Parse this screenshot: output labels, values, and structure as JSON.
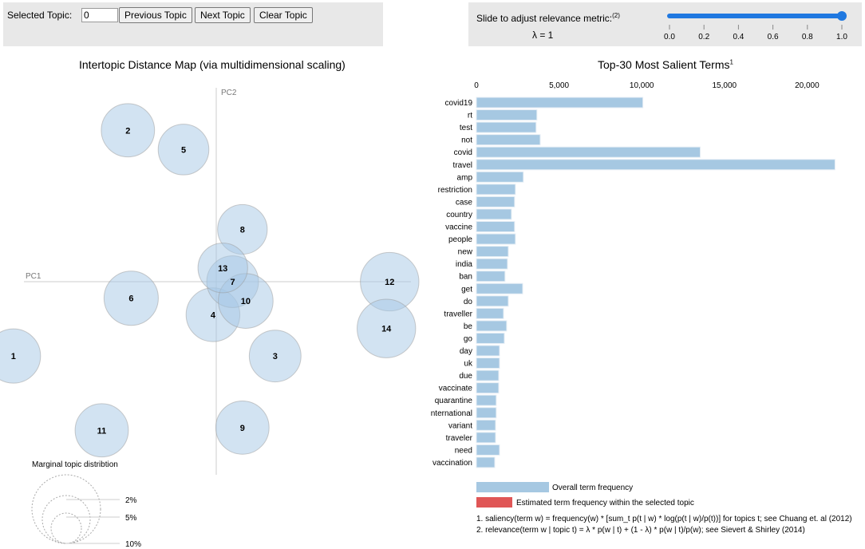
{
  "controls": {
    "selected_topic_label": "Selected Topic:",
    "selected_topic_value": "0",
    "previous_label": "Previous Topic",
    "next_label": "Next Topic",
    "clear_label": "Clear Topic",
    "slider_label": "Slide to adjust relevance metric:",
    "slider_footnote": "(2)",
    "lambda_text": "λ = 1",
    "slider_value": 1.0,
    "slider_ticks": [
      "0.0",
      "0.2",
      "0.4",
      "0.6",
      "0.8",
      "1.0"
    ],
    "slider_color": "#1f78e0"
  },
  "chart_data": [
    {
      "type": "scatter",
      "title": "Intertopic Distance Map (via multidimensional scaling)",
      "xlabel": "PC1",
      "ylabel": "PC2",
      "bubble_color": "#a6c8e6",
      "topics": [
        {
          "id": 1,
          "x": -0.62,
          "y": -0.27,
          "size_pct": 5.5
        },
        {
          "id": 2,
          "x": -0.27,
          "y": 0.55,
          "size_pct": 5.3
        },
        {
          "id": 3,
          "x": 0.18,
          "y": -0.27,
          "size_pct": 5.0
        },
        {
          "id": 4,
          "x": -0.01,
          "y": -0.12,
          "size_pct": 5.4
        },
        {
          "id": 5,
          "x": -0.1,
          "y": 0.48,
          "size_pct": 4.8
        },
        {
          "id": 6,
          "x": -0.26,
          "y": -0.06,
          "size_pct": 5.5
        },
        {
          "id": 7,
          "x": 0.05,
          "y": 0.0,
          "size_pct": 5.0
        },
        {
          "id": 8,
          "x": 0.08,
          "y": 0.19,
          "size_pct": 4.6
        },
        {
          "id": 9,
          "x": 0.08,
          "y": -0.53,
          "size_pct": 5.3
        },
        {
          "id": 10,
          "x": 0.09,
          "y": -0.07,
          "size_pct": 5.6
        },
        {
          "id": 11,
          "x": -0.35,
          "y": -0.54,
          "size_pct": 5.3
        },
        {
          "id": 12,
          "x": 0.53,
          "y": 0.0,
          "size_pct": 6.4
        },
        {
          "id": 13,
          "x": 0.02,
          "y": 0.05,
          "size_pct": 4.6
        },
        {
          "id": 14,
          "x": 0.52,
          "y": -0.17,
          "size_pct": 6.4
        }
      ],
      "legend": {
        "title": "Marginal topic distribtion",
        "entries": [
          "2%",
          "5%",
          "10%"
        ]
      }
    },
    {
      "type": "bar",
      "orientation": "horizontal",
      "title": "Top-30 Most Salient Terms",
      "title_footnote": "1",
      "xlim": [
        0,
        22500
      ],
      "xticks": [
        0,
        5000,
        10000,
        15000,
        20000
      ],
      "xtick_labels": [
        "0",
        "5,000",
        "10,000",
        "15,000",
        "20,000"
      ],
      "categories": [
        "covid19",
        "rt",
        "test",
        "not",
        "covid",
        "travel",
        "amp",
        "restriction",
        "case",
        "country",
        "vaccine",
        "people",
        "new",
        "india",
        "ban",
        "get",
        "do",
        "traveller",
        "be",
        "go",
        "day",
        "uk",
        "due",
        "vaccinate",
        "quarantine",
        "international",
        "variant",
        "traveler",
        "need",
        "vaccination"
      ],
      "series": [
        {
          "name": "Overall term frequency",
          "color": "#a6c8e2",
          "values": [
            10070,
            3660,
            3610,
            3860,
            13540,
            21690,
            2840,
            2360,
            2310,
            2120,
            2310,
            2360,
            1930,
            1880,
            1730,
            2800,
            1930,
            1640,
            1830,
            1690,
            1400,
            1400,
            1350,
            1350,
            1200,
            1200,
            1160,
            1160,
            1400,
            1110
          ]
        }
      ],
      "legend": [
        {
          "label": "Overall term frequency",
          "color": "#a6c8e2"
        },
        {
          "label": "Estimated term frequency within the selected topic",
          "color": "#e05656"
        }
      ],
      "footnotes": [
        "1. saliency(term w) = frequency(w) * [sum_t p(t | w) * log(p(t | w)/p(t))] for topics t; see Chuang et. al (2012)",
        "2. relevance(term w | topic t) = λ * p(w | t) + (1 - λ) * p(w | t)/p(w); see Sievert & Shirley (2014)"
      ]
    }
  ]
}
